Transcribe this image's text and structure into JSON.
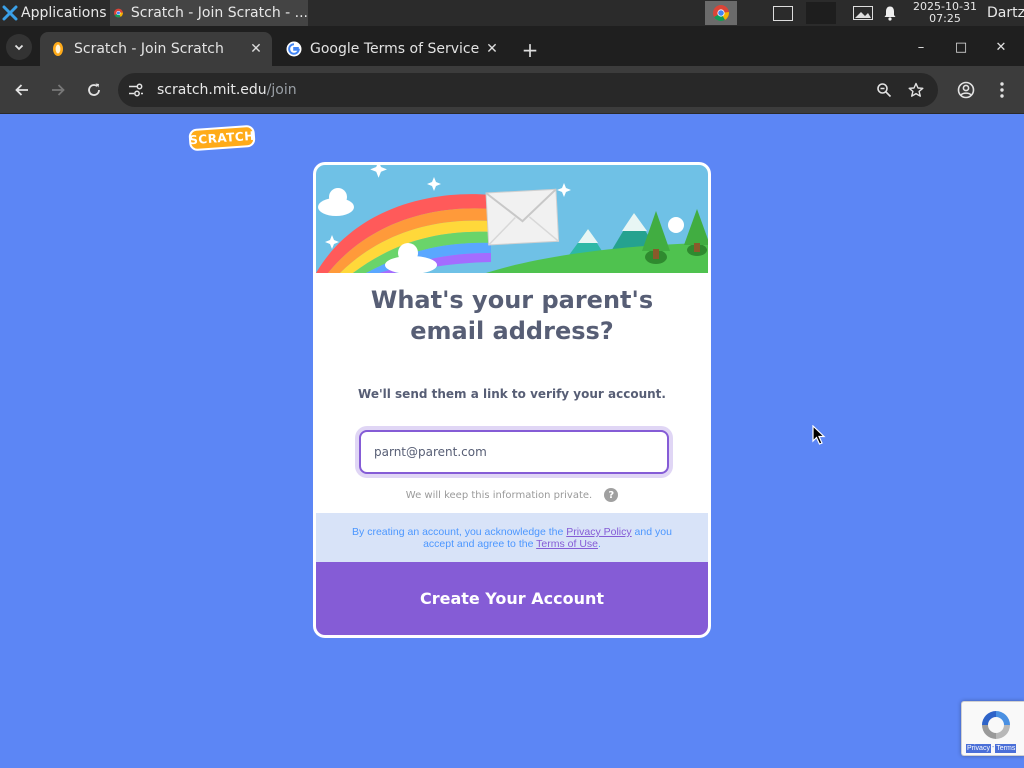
{
  "taskbar": {
    "apps_label": "Applications",
    "apps_suffix": "☰",
    "task_title": "Scratch - Join Scratch - ...",
    "date": "2025-10-31",
    "time": "07:25",
    "user": "Dartz"
  },
  "tabs": [
    {
      "title": "Scratch - Join Scratch",
      "close": "✕"
    },
    {
      "title": "Google Terms of Service",
      "close": "✕"
    }
  ],
  "new_tab": "+",
  "window_controls": {
    "minimize": "–",
    "maximize": "□",
    "close": "✕"
  },
  "address_bar": {
    "domain": "scratch.mit.edu",
    "path": "/join"
  },
  "page": {
    "logo_text": "SCRATCH",
    "title_line1": "What's your parent's",
    "title_line2": "email address?",
    "subtitle": "We'll send them a link to verify your account.",
    "email_value": "parnt@parent.com",
    "private_note": "We will keep this information private.",
    "help_glyph": "?",
    "legal_pre": "By creating an account, you acknowledge the ",
    "privacy_link": "Privacy Policy",
    "legal_mid": " and you accept and agree to the ",
    "terms_link": "Terms of Use",
    "legal_post": ".",
    "submit_label": "Create Your Account"
  },
  "recaptcha": {
    "privacy": "Privacy",
    "sep": "-",
    "terms": "Terms"
  },
  "colors": {
    "page_background": "#5c86f5",
    "accent_purple": "#855cd6",
    "scratch_orange": "#ffab19",
    "text_gray": "#575e75",
    "legal_background": "#d8e3f8"
  }
}
